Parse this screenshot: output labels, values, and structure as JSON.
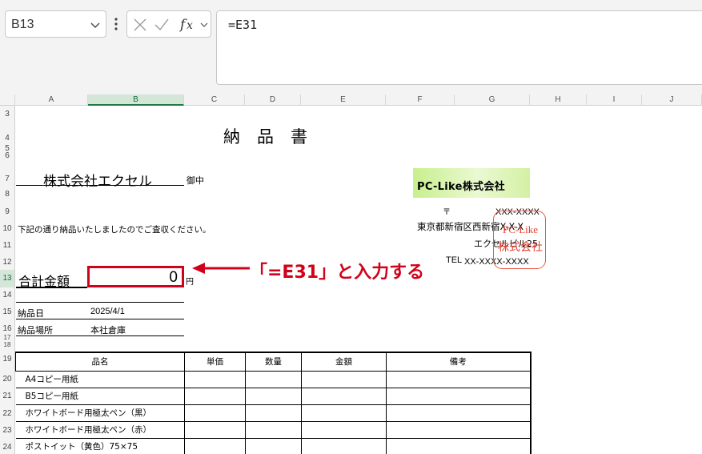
{
  "formula_bar": {
    "name_box": "B13",
    "formula": "=E31"
  },
  "columns": [
    "A",
    "B",
    "C",
    "D",
    "E",
    "F",
    "G",
    "H",
    "I",
    "J"
  ],
  "rows": [
    "3",
    "4",
    "5",
    "6",
    "7",
    "8",
    "9",
    "10",
    "11",
    "12",
    "13",
    "14",
    "15",
    "16",
    "17",
    "18",
    "19",
    "20",
    "21",
    "22",
    "23",
    "24"
  ],
  "sheet": {
    "title": "納品書",
    "customer": "株式会社エクセル",
    "honorific": "御中",
    "message": "下記の通り納品いたしましたのでご査収ください。",
    "total_label": "合計金額",
    "total_value": "0",
    "total_unit": "円",
    "company_logo": "PC-Like株式会社",
    "postal_mark": "〒",
    "postal_code": "XXX-XXXX",
    "address": "東京都新宿区西新宿X-X-X",
    "building": "エクセルビル25",
    "tel_label": "TEL",
    "tel": "XX-XXXX-XXXX",
    "stamp_line1": "PC-Like",
    "stamp_line2": "株式会社",
    "delivery_date_label": "納品日",
    "delivery_date": "2025/4/1",
    "delivery_place_label": "納品場所",
    "delivery_place": "本社倉庫"
  },
  "annotation": {
    "callout": "「=E31」と入力する",
    "color": "#d0021b"
  },
  "items_table": {
    "headers": [
      "品名",
      "単価",
      "数量",
      "金額",
      "備考"
    ],
    "rows": [
      [
        "A4コピー用紙",
        "",
        "",
        "",
        ""
      ],
      [
        "B5コピー用紙",
        "",
        "",
        "",
        ""
      ],
      [
        "ホワイトボード用極太ペン（黒）",
        "",
        "",
        "",
        ""
      ],
      [
        "ホワイトボード用極太ペン（赤）",
        "",
        "",
        "",
        ""
      ],
      [
        "ポストイット（黄色）75×75",
        "",
        "",
        "",
        ""
      ]
    ]
  },
  "colors": {
    "accent_red": "#d0021b",
    "stamp_red": "#e0402f",
    "selection_green": "#1f7a45"
  }
}
